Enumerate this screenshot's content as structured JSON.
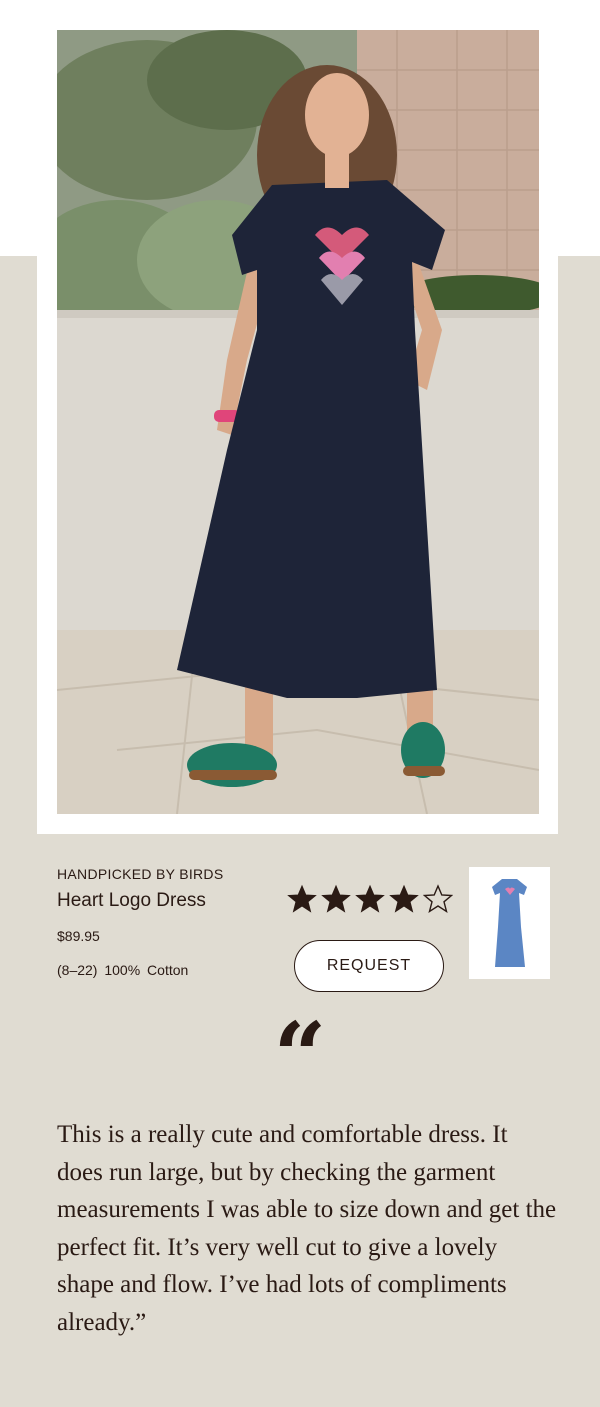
{
  "product": {
    "brand": "HANDPICKED BY BIRDS",
    "name": "Heart Logo Dress",
    "price": "$89.95",
    "details": "(8–22)  100% Cotton",
    "rating": 4,
    "rating_max": 5,
    "request_label": "REQUEST"
  },
  "review": {
    "quote_mark": "“",
    "text": "This is a really cute and comfortable dress. It does run large, but by checking the garment measurements I was able to size down and get the perfect fit. It’s very well cut to give a lovely shape and flow. I’ve had lots of compliments already.”"
  },
  "colors": {
    "background": "#e0dcd2",
    "text": "#2a1a14",
    "dress": "#1e2438",
    "thumb_dress": "#5b86c4"
  }
}
